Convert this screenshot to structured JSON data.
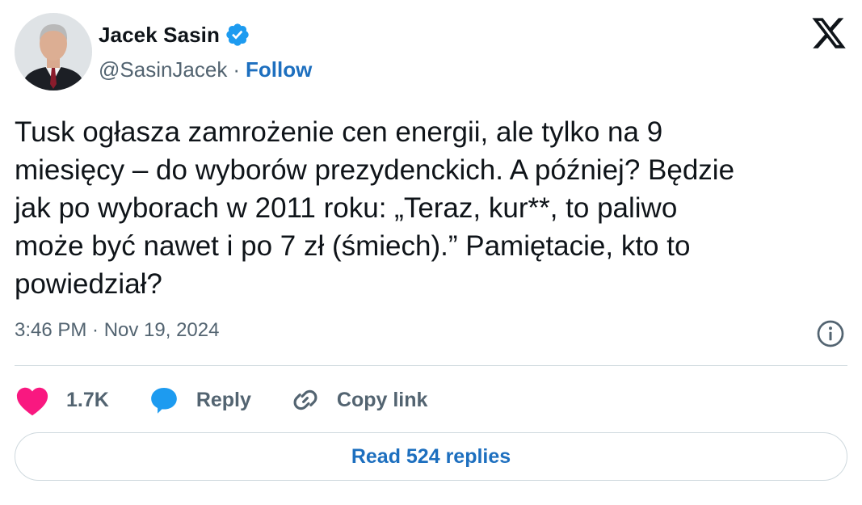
{
  "author": {
    "display_name": "Jacek Sasin",
    "handle": "@SasinJacek",
    "separator": "·",
    "follow_label": "Follow",
    "avatar_icon": "profile-photo",
    "verified_icon": "verified-badge-icon",
    "verified_color": "#1d9bf0"
  },
  "brand": {
    "logo_icon": "x-logo-icon"
  },
  "tweet": {
    "text": "Tusk ogłasza zamrożenie cen energii, ale tylko na 9\nmiesięcy – do wyborów prezydenckich. A później? Będzie\njak po wyborach w 2011 roku: „Teraz, kur**, to paliwo\nmoże być nawet i po 7 zł (śmiech).” Pamiętacie, kto to\npowiedział?",
    "timestamp": "3:46 PM · Nov 19, 2024",
    "info_icon": "info-icon"
  },
  "actions": {
    "likes_count": "1.7K",
    "like_icon": "heart-icon",
    "like_color": "#f91880",
    "reply_label": "Reply",
    "reply_icon": "speech-bubble-icon",
    "reply_color": "#1d9bf0",
    "copy_link_label": "Copy link",
    "copy_link_icon": "link-icon"
  },
  "footer": {
    "read_replies_label": "Read 524 replies"
  },
  "colors": {
    "text_primary": "#0f1419",
    "text_secondary": "#536471",
    "link_blue": "#1d6fbf",
    "border": "#cfd9de"
  }
}
